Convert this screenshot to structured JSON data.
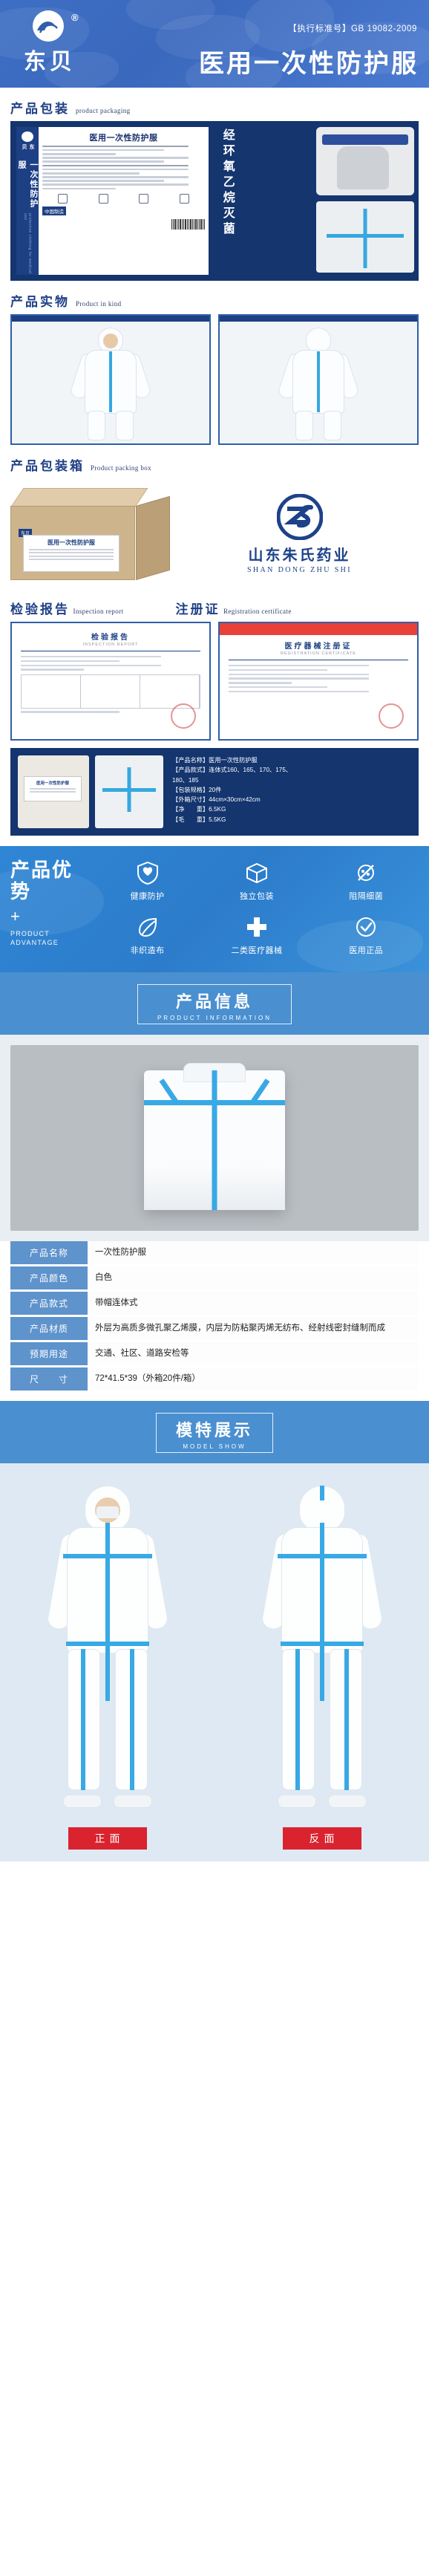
{
  "header": {
    "brand_cn": "东贝",
    "registered_mark": "®",
    "standard_no": "【执行标准号】GB 19082-2009",
    "title": "医用一次性防护服",
    "bg_color": "#3a68bd"
  },
  "sections": {
    "packaging": {
      "cn": "产品包装",
      "en": "product packaging"
    },
    "in_kind": {
      "cn": "产品实物",
      "en": "Product in kind"
    },
    "packing_box": {
      "cn": "产品包装箱",
      "en": "Product packing box"
    },
    "inspection": {
      "cn": "检验报告",
      "en": "Inspection report"
    },
    "registration": {
      "cn": "注册证",
      "en": "Registration certificate"
    }
  },
  "package_panel": {
    "label_title": "医用一次性防护服",
    "side_brand_cn": "东贝",
    "side_vertical_cn": "一次性防护服",
    "side_vertical_en": "protective clothing for medical use",
    "made_in": "中国制造",
    "sterilize_text": "经环氧乙烷灭菌"
  },
  "brand_block": {
    "logo_text": "ZS",
    "name_cn": "山东朱氏药业",
    "name_en": "SHAN DONG ZHU SHI",
    "color": "#1d4289"
  },
  "carton": {
    "label_title": "医用一次性防护服",
    "badge": "东贝"
  },
  "documents": {
    "report": {
      "title": "检验报告",
      "sub": "INSPECTION REPORT"
    },
    "certificate": {
      "title": "医疗器械注册证",
      "sub": "REGISTRATION CERTIFICATE"
    }
  },
  "spec_strip": {
    "rows": [
      "【产品名称】医用一次性防护服",
      "【产品款式】连体式160、165、170、175、",
      "180、185",
      "【包装规格】20件",
      "【外箱尺寸】44cm×30cm×42cm",
      "【净　　重】6.5KG",
      "【毛　　重】5.5KG"
    ]
  },
  "advantage": {
    "title_cn": "产品优势",
    "plus": "+",
    "title_en_1": "PRODUCT",
    "title_en_2": "ADVANTAGE",
    "items": [
      {
        "label": "健康防护",
        "icon": "shield-icon"
      },
      {
        "label": "独立包装",
        "icon": "box-icon"
      },
      {
        "label": "阻隔细菌",
        "icon": "germ-block-icon"
      },
      {
        "label": "非织造布",
        "icon": "leaf-icon"
      },
      {
        "label": "二类医疗器械",
        "icon": "cross-icon"
      },
      {
        "label": "医用正品",
        "icon": "badge-check-icon"
      }
    ],
    "bg_color": "#2f86d4"
  },
  "product_info_banner": {
    "cn": "产品信息",
    "en": "PRODUCT INFORMATION"
  },
  "info_table": {
    "rows": [
      {
        "key": "产品名称",
        "value": "一次性防护服"
      },
      {
        "key": "产品颜色",
        "value": "白色"
      },
      {
        "key": "产品款式",
        "value": "带帽连体式"
      },
      {
        "key": "产品材质",
        "value": "外层为高质多微孔聚乙烯膜，内层为防粘聚丙烯无纺布、经射线密封缝制而成"
      },
      {
        "key": "预期用途",
        "value": "交通、社区、道路安检等"
      },
      {
        "key": "尺　　寸",
        "value": "72*41.5*39（外箱20件/箱）"
      }
    ],
    "key_bg": "#5e93cc"
  },
  "model_show_banner": {
    "cn": "模特展示",
    "en": "MODEL SHOW"
  },
  "model_captions": [
    {
      "label": "正面",
      "color": "#d9232e"
    },
    {
      "label": "反面",
      "color": "#d9232e"
    }
  ]
}
